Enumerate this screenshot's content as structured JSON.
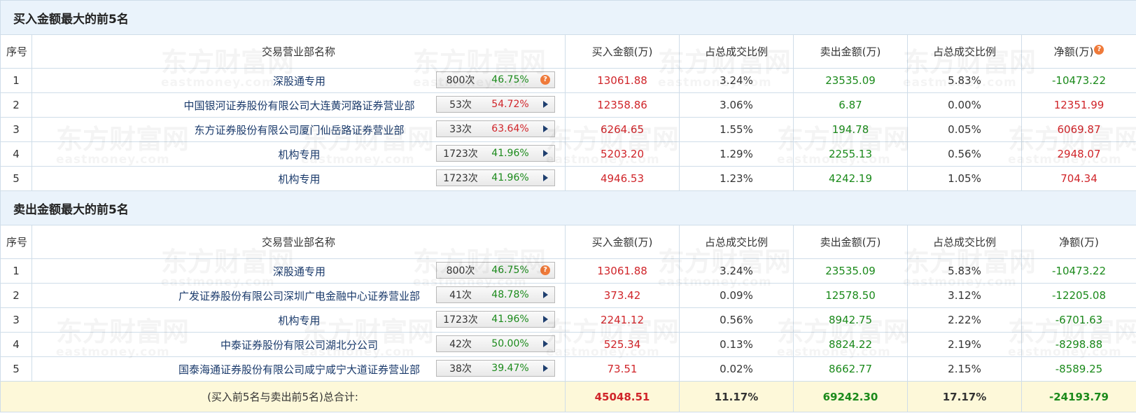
{
  "buy_section": {
    "title": "买入金额最大的前5名",
    "headers": [
      "序号",
      "交易营业部名称",
      "买入金额(万)",
      "占总成交比例",
      "卖出金额(万)",
      "占总成交比例",
      "净额(万)"
    ],
    "rows": [
      {
        "idx": "1",
        "name": "深股通专用",
        "count": "800次",
        "rate": "46.75%",
        "rate_color": "green",
        "action": "help",
        "buy": "13061.88",
        "buy_pct": "3.24%",
        "sell": "23535.09",
        "sell_pct": "5.83%",
        "net": "-10473.22",
        "net_color": "green"
      },
      {
        "idx": "2",
        "name": "中国银河证券股份有限公司大连黄河路证券营业部",
        "count": "53次",
        "rate": "54.72%",
        "rate_color": "red",
        "action": "expand",
        "buy": "12358.86",
        "buy_pct": "3.06%",
        "sell": "6.87",
        "sell_pct": "0.00%",
        "net": "12351.99",
        "net_color": "red"
      },
      {
        "idx": "3",
        "name": "东方证券股份有限公司厦门仙岳路证券营业部",
        "count": "33次",
        "rate": "63.64%",
        "rate_color": "red",
        "action": "expand",
        "buy": "6264.65",
        "buy_pct": "1.55%",
        "sell": "194.78",
        "sell_pct": "0.05%",
        "net": "6069.87",
        "net_color": "red"
      },
      {
        "idx": "4",
        "name": "机构专用",
        "count": "1723次",
        "rate": "41.96%",
        "rate_color": "green",
        "action": "expand",
        "buy": "5203.20",
        "buy_pct": "1.29%",
        "sell": "2255.13",
        "sell_pct": "0.56%",
        "net": "2948.07",
        "net_color": "red"
      },
      {
        "idx": "5",
        "name": "机构专用",
        "count": "1723次",
        "rate": "41.96%",
        "rate_color": "green",
        "action": "expand",
        "buy": "4946.53",
        "buy_pct": "1.23%",
        "sell": "4242.19",
        "sell_pct": "1.05%",
        "net": "704.34",
        "net_color": "red"
      }
    ]
  },
  "sell_section": {
    "title": "卖出金额最大的前5名",
    "headers": [
      "序号",
      "交易营业部名称",
      "买入金额(万)",
      "占总成交比例",
      "卖出金额(万)",
      "占总成交比例",
      "净额(万)"
    ],
    "rows": [
      {
        "idx": "1",
        "name": "深股通专用",
        "count": "800次",
        "rate": "46.75%",
        "rate_color": "green",
        "action": "help",
        "buy": "13061.88",
        "buy_pct": "3.24%",
        "sell": "23535.09",
        "sell_pct": "5.83%",
        "net": "-10473.22",
        "net_color": "green"
      },
      {
        "idx": "2",
        "name": "广发证券股份有限公司深圳广电金融中心证券营业部",
        "count": "41次",
        "rate": "48.78%",
        "rate_color": "green",
        "action": "expand",
        "buy": "373.42",
        "buy_pct": "0.09%",
        "sell": "12578.50",
        "sell_pct": "3.12%",
        "net": "-12205.08",
        "net_color": "green"
      },
      {
        "idx": "3",
        "name": "机构专用",
        "count": "1723次",
        "rate": "41.96%",
        "rate_color": "green",
        "action": "expand",
        "buy": "2241.12",
        "buy_pct": "0.56%",
        "sell": "8942.75",
        "sell_pct": "2.22%",
        "net": "-6701.63",
        "net_color": "green"
      },
      {
        "idx": "4",
        "name": "中泰证券股份有限公司湖北分公司",
        "count": "42次",
        "rate": "50.00%",
        "rate_color": "green",
        "action": "expand",
        "buy": "525.34",
        "buy_pct": "0.13%",
        "sell": "8824.22",
        "sell_pct": "2.19%",
        "net": "-8298.88",
        "net_color": "green"
      },
      {
        "idx": "5",
        "name": "国泰海通证券股份有限公司咸宁咸宁大道证券营业部",
        "count": "38次",
        "rate": "39.47%",
        "rate_color": "green",
        "action": "expand",
        "buy": "73.51",
        "buy_pct": "0.02%",
        "sell": "8662.77",
        "sell_pct": "2.15%",
        "net": "-8589.25",
        "net_color": "green"
      }
    ]
  },
  "total": {
    "label": "(买入前5名与卖出前5名)总合计:",
    "buy": "45048.51",
    "buy_pct": "11.17%",
    "sell": "69242.30",
    "sell_pct": "17.17%",
    "net": "-24193.79"
  },
  "watermark": {
    "text": "东方财富网",
    "sub": "eastmoney.com"
  },
  "help_icon": "question-mark-icon",
  "expand_icon": "play-triangle-icon",
  "colors": {
    "red": "#d0252a",
    "green": "#1b8a1b",
    "section_bg": "#eaf3fb",
    "total_bg": "#fdf8d9",
    "border": "#cfdde9"
  }
}
